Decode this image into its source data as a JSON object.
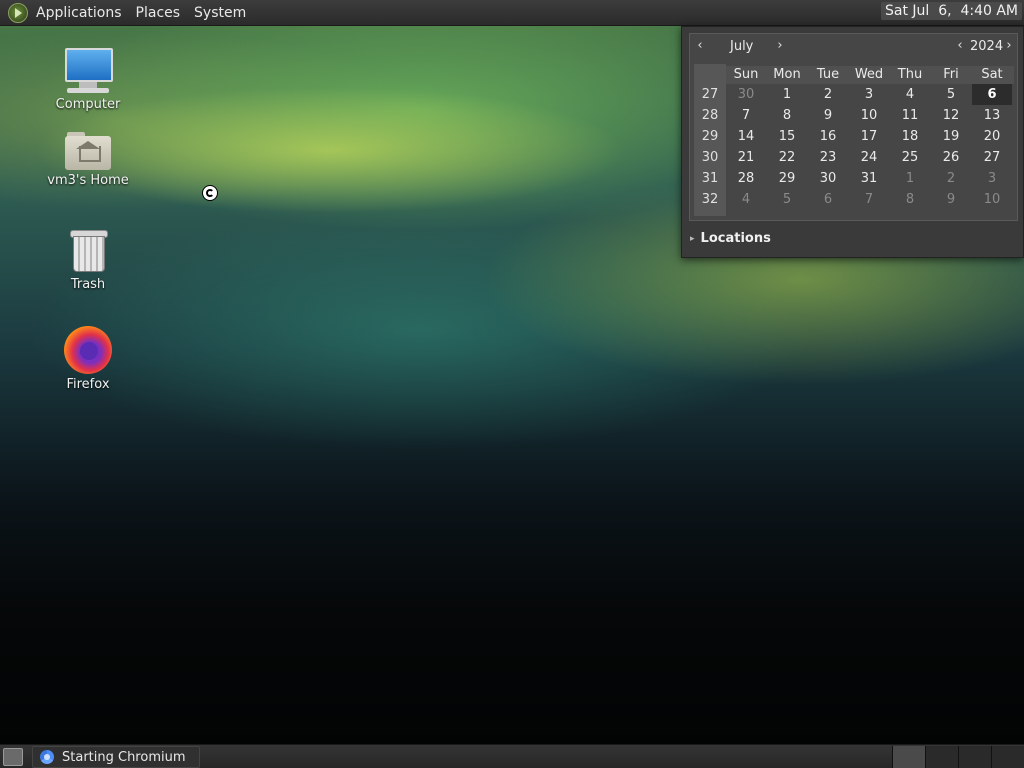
{
  "top_panel": {
    "menus": [
      "Applications",
      "Places",
      "System"
    ],
    "clock": "Sat Jul  6,  4:40 AM"
  },
  "desktop_icons": [
    {
      "label": "Computer",
      "icon": "computer-icon"
    },
    {
      "label": "vm3's Home",
      "icon": "home-folder-icon"
    },
    {
      "label": "Trash",
      "icon": "trash-icon"
    },
    {
      "label": "Firefox",
      "icon": "firefox-icon"
    }
  ],
  "calendar": {
    "month": "July",
    "year": "2024",
    "prev_month": "‹",
    "next_month": "›",
    "prev_year": "‹",
    "next_year": "›",
    "weekdays": [
      "Sun",
      "Mon",
      "Tue",
      "Wed",
      "Thu",
      "Fri",
      "Sat"
    ],
    "week_numbers": [
      "27",
      "28",
      "29",
      "30",
      "31",
      "32"
    ],
    "weeks": [
      [
        "30",
        "1",
        "2",
        "3",
        "4",
        "5",
        "6"
      ],
      [
        "7",
        "8",
        "9",
        "10",
        "11",
        "12",
        "13"
      ],
      [
        "14",
        "15",
        "16",
        "17",
        "18",
        "19",
        "20"
      ],
      [
        "21",
        "22",
        "23",
        "24",
        "25",
        "26",
        "27"
      ],
      [
        "28",
        "29",
        "30",
        "31",
        "1",
        "2",
        "3"
      ],
      [
        "4",
        "5",
        "6",
        "7",
        "8",
        "9",
        "10"
      ]
    ],
    "today": "6",
    "locations_label": "Locations"
  },
  "bottom_panel": {
    "taskbar_item": "Starting Chromium",
    "workspaces": 4
  }
}
